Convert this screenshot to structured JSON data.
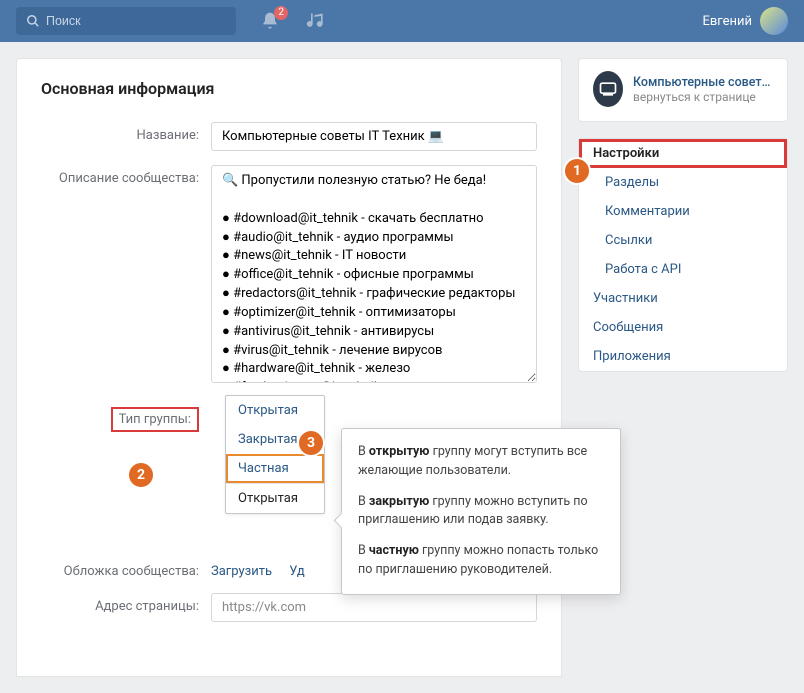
{
  "header": {
    "search_placeholder": "Поиск",
    "notif_badge": "2",
    "username": "Евгений"
  },
  "page_title": "Основная информация",
  "form": {
    "name_label": "Название:",
    "name_value": "Компьютерные советы IT Техник 💻",
    "desc_label": "Описание сообщества:",
    "desc_value": "🔍 Пропустили полезную статью? Не беда!\n\n● #download@it_tehnik - скачать бесплатно\n● #audio@it_tehnik - аудио программы\n● #news@it_tehnik - IT новости\n● #office@it_tehnik - офисные программы\n● #redactors@it_tehnik - графические редакторы\n● #optimizer@it_tehnik - оптимизаторы\n● #antivirus@it_tehnik - антивирусы\n● #virus@it_tehnik - лечение вирусов\n● #hardware@it_tehnik - железо\n● #for_beginners@it_tehnik - новичкам\n● #browsers@it_tehnik - браузеры",
    "type_label": "Тип группы:",
    "type_options": {
      "a": "Открытая",
      "b": "Закрытая",
      "c": "Частная"
    },
    "type_selected": "Открытая",
    "cover_label": "Обложка сообщества:",
    "cover_upload": "Загрузить",
    "cover_delete": "Уд",
    "addr_label": "Адрес страницы:",
    "addr_value": "https://vk.com"
  },
  "popover": {
    "p1a": "В ",
    "p1b": "открытую",
    "p1c": " группу могут вступить все желающие пользователи.",
    "p2a": "В ",
    "p2b": "закрытую",
    "p2c": " группу можно вступить по приглашению или подав заявку.",
    "p3a": "В ",
    "p3b": "частную",
    "p3c": " группу можно попасть только по приглашению руководителей."
  },
  "right": {
    "group_name": "Компьютерные советы I…",
    "group_back": "вернуться к странице",
    "menu": {
      "settings": "Настройки",
      "sections": "Разделы",
      "comments": "Комментарии",
      "links": "Ссылки",
      "api": "Работа с API",
      "members": "Участники",
      "messages": "Сообщения",
      "apps": "Приложения"
    }
  },
  "anno": {
    "one": "1",
    "two": "2",
    "three": "3"
  }
}
